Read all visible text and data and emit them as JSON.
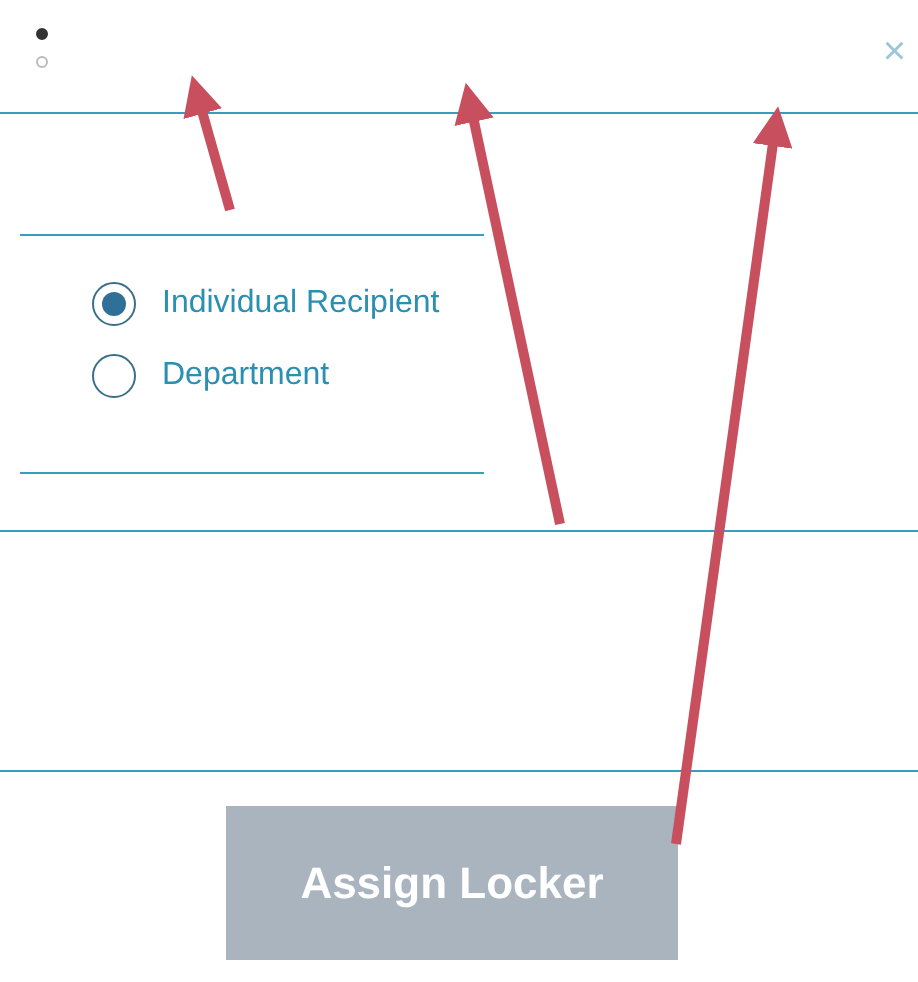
{
  "header": {
    "mini_options": [
      {
        "selected": true
      },
      {
        "selected": false
      }
    ],
    "close": "×"
  },
  "recipient_type": {
    "options": [
      {
        "label": "Individual Recipient",
        "selected": true
      },
      {
        "label": "Department",
        "selected": false
      }
    ]
  },
  "button": {
    "label": "Assign Locker",
    "disabled": true
  }
}
